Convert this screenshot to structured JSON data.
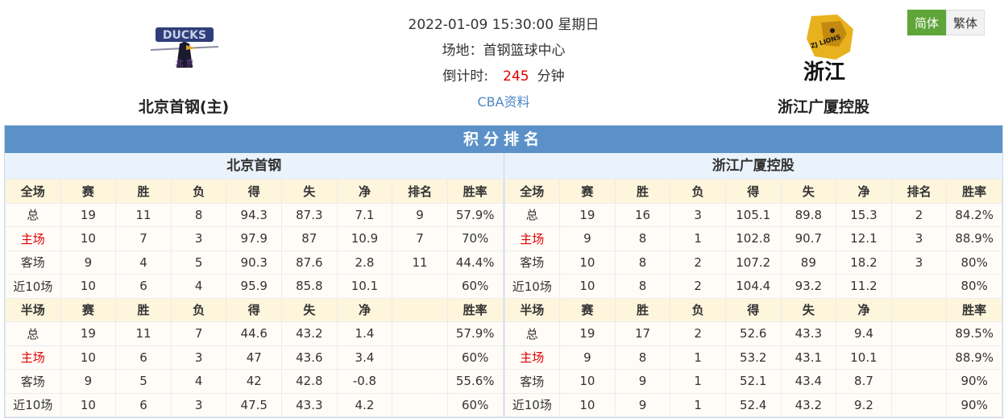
{
  "header": {
    "datetime": "2022-01-09 15:30:00 星期日",
    "venue": "场地：首钢篮球中心",
    "countdown_label": "倒计时:",
    "countdown_value": "245",
    "countdown_unit": "分钟",
    "cba_link": "CBA资料"
  },
  "home_team": {
    "name": "北京首钢(主)",
    "logo_text": "DUCKS",
    "logo_sub": "北 京"
  },
  "away_team": {
    "name": "浙江广厦控股",
    "logo_text": "浙江",
    "logo_sub": "ZJ LIONS"
  },
  "lang": {
    "simplified": "简体",
    "traditional": "繁体"
  },
  "standings": {
    "title": "积分排名",
    "home_name": "北京首钢",
    "away_name": "浙江广厦控股",
    "full_headers": [
      "全场",
      "赛",
      "胜",
      "负",
      "得",
      "失",
      "净",
      "排名",
      "胜率"
    ],
    "half_headers": [
      "半场",
      "赛",
      "胜",
      "负",
      "得",
      "失",
      "净",
      "",
      "胜率"
    ],
    "home_full": [
      [
        "总",
        "19",
        "11",
        "8",
        "94.3",
        "87.3",
        "7.1",
        "9",
        "57.9%"
      ],
      [
        "主场",
        "10",
        "7",
        "3",
        "97.9",
        "87",
        "10.9",
        "7",
        "70%"
      ],
      [
        "客场",
        "9",
        "4",
        "5",
        "90.3",
        "87.6",
        "2.8",
        "11",
        "44.4%"
      ],
      [
        "近10场",
        "10",
        "6",
        "4",
        "95.9",
        "85.8",
        "10.1",
        "",
        "60%"
      ]
    ],
    "home_half": [
      [
        "总",
        "19",
        "11",
        "7",
        "44.6",
        "43.2",
        "1.4",
        "",
        "57.9%"
      ],
      [
        "主场",
        "10",
        "6",
        "3",
        "47",
        "43.6",
        "3.4",
        "",
        "60%"
      ],
      [
        "客场",
        "9",
        "5",
        "4",
        "42",
        "42.8",
        "-0.8",
        "",
        "55.6%"
      ],
      [
        "近10场",
        "10",
        "6",
        "3",
        "47.5",
        "43.3",
        "4.2",
        "",
        "60%"
      ]
    ],
    "away_full": [
      [
        "总",
        "19",
        "16",
        "3",
        "105.1",
        "89.8",
        "15.3",
        "2",
        "84.2%"
      ],
      [
        "主场",
        "9",
        "8",
        "1",
        "102.8",
        "90.7",
        "12.1",
        "3",
        "88.9%"
      ],
      [
        "客场",
        "10",
        "8",
        "2",
        "107.2",
        "89",
        "18.2",
        "3",
        "80%"
      ],
      [
        "近10场",
        "10",
        "8",
        "2",
        "104.4",
        "93.2",
        "11.2",
        "",
        "80%"
      ]
    ],
    "away_half": [
      [
        "总",
        "19",
        "17",
        "2",
        "52.6",
        "43.3",
        "9.4",
        "",
        "89.5%"
      ],
      [
        "主场",
        "9",
        "8",
        "1",
        "53.2",
        "43.1",
        "10.1",
        "",
        "88.9%"
      ],
      [
        "客场",
        "10",
        "9",
        "1",
        "52.1",
        "43.4",
        "8.7",
        "",
        "90%"
      ],
      [
        "近10场",
        "10",
        "9",
        "1",
        "52.4",
        "43.2",
        "9.2",
        "",
        "90%"
      ]
    ]
  }
}
